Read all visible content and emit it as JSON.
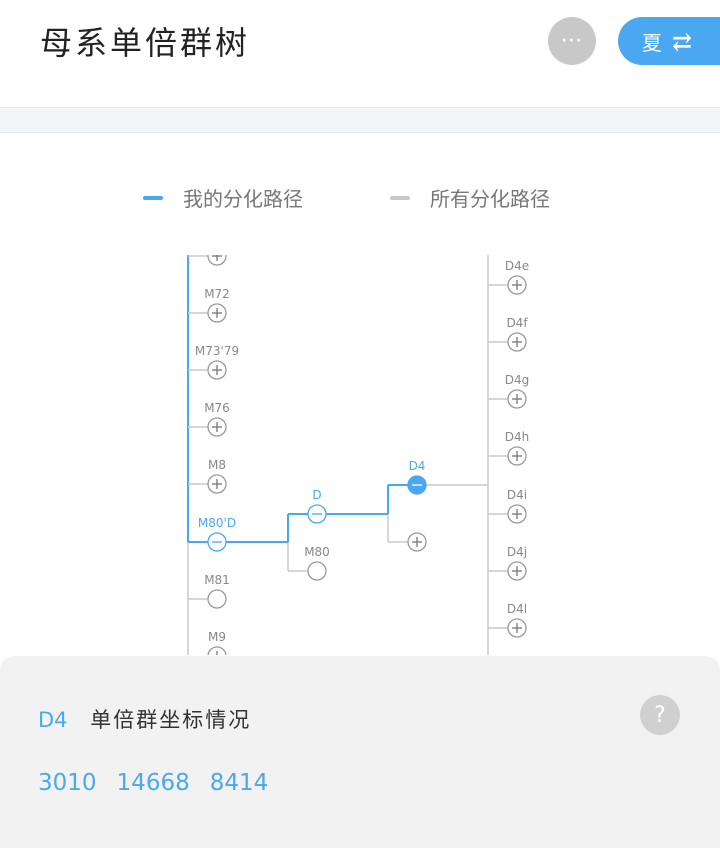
{
  "header": {
    "title": "母系单倍群树",
    "more_label": "⋯",
    "season_label": "夏",
    "swap_icon": "⇄"
  },
  "legend": {
    "mine": {
      "label": "我的分化路径",
      "color": "#4aa8f0"
    },
    "all": {
      "label": "所有分化路径",
      "color": "#c8c8c8"
    }
  },
  "tree": {
    "columns": [
      {
        "nodes": [
          {
            "label": "",
            "state": "plus"
          },
          {
            "label": "M72",
            "state": "plus"
          },
          {
            "label": "M73'79",
            "state": "plus"
          },
          {
            "label": "M76",
            "state": "plus"
          },
          {
            "label": "M8",
            "state": "plus"
          },
          {
            "label": "M80'D",
            "state": "minus",
            "on_path": true
          },
          {
            "label": "M81",
            "state": "empty"
          },
          {
            "label": "M9",
            "state": "plus"
          }
        ]
      },
      {
        "nodes": [
          {
            "label": "D",
            "state": "minus",
            "on_path": true
          },
          {
            "label": "M80",
            "state": "empty"
          }
        ]
      },
      {
        "nodes": [
          {
            "label": "D4",
            "state": "minus-filled",
            "on_path": true
          },
          {
            "label": "",
            "state": "plus"
          }
        ]
      },
      {
        "nodes": [
          {
            "label": "D4e",
            "state": "plus"
          },
          {
            "label": "D4f",
            "state": "plus"
          },
          {
            "label": "D4g",
            "state": "plus"
          },
          {
            "label": "D4h",
            "state": "plus"
          },
          {
            "label": "D4i",
            "state": "plus"
          },
          {
            "label": "D4j",
            "state": "plus"
          },
          {
            "label": "D4l",
            "state": "plus"
          }
        ]
      }
    ]
  },
  "panel": {
    "haplogroup": "D4",
    "title": "单倍群坐标情况",
    "help_label": "?",
    "coordinates": [
      "3010",
      "14668",
      "8414"
    ]
  }
}
